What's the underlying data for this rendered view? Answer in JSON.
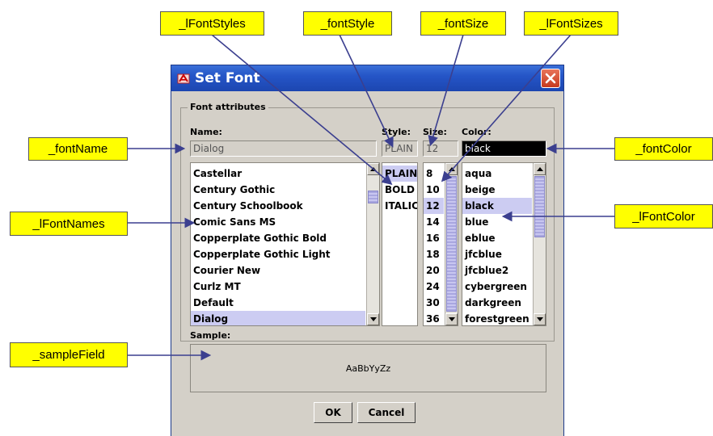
{
  "callouts": {
    "lFontStyles": "_lFontStyles",
    "fontStyle": "_fontStyle",
    "fontSize": "_fontSize",
    "lFontSizes": "_lFontSizes",
    "fontName": "_fontName",
    "fontColor": "_fontColor",
    "lFontNames": "_lFontNames",
    "lFontColor": "_lFontColor",
    "sampleField": "_sampleField"
  },
  "dialog": {
    "title": "Set Font",
    "group_title": "Font attributes",
    "labels": {
      "name": "Name:",
      "style": "Style:",
      "size": "Size:",
      "color": "Color:",
      "sample": "Sample:"
    },
    "fields": {
      "name": "Dialog",
      "style": "PLAIN",
      "size": "12",
      "color": "black"
    },
    "font_names": [
      "Castellar",
      "Century Gothic",
      "Century Schoolbook",
      "Comic Sans MS",
      "Copperplate Gothic Bold",
      "Copperplate Gothic Light",
      "Courier New",
      "Curlz MT",
      "Default",
      "Dialog"
    ],
    "font_styles": [
      "PLAIN",
      "BOLD",
      "ITALIC"
    ],
    "font_sizes": [
      "8",
      "10",
      "12",
      "14",
      "16",
      "18",
      "20",
      "24",
      "30",
      "36"
    ],
    "font_colors": [
      "aqua",
      "beige",
      "black",
      "blue",
      "eblue",
      "jfcblue",
      "jfcblue2",
      "cybergreen",
      "darkgreen",
      "forestgreen"
    ],
    "selected": {
      "font_name": "Dialog",
      "font_style": "PLAIN",
      "font_size": "12",
      "font_color": "black"
    },
    "sample_text": "AaBbYyZz",
    "buttons": {
      "ok": "OK",
      "cancel": "Cancel"
    }
  },
  "colors": {
    "callout_bg": "#ffff00",
    "titlebar": "#2555c7",
    "selection": "#ccccf2",
    "dialog_bg": "#d4d0c8",
    "arrow": "#3b3f8f"
  }
}
